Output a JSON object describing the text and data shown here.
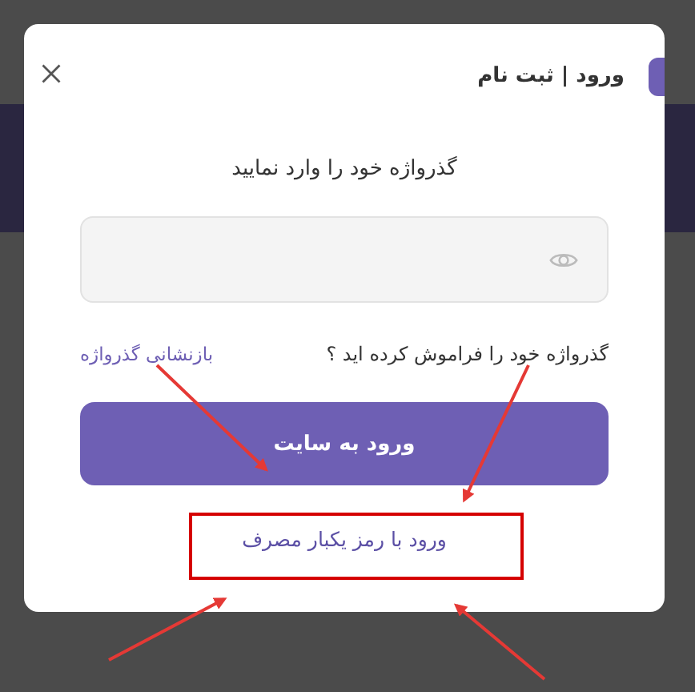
{
  "dialog": {
    "title": "ورود | ثبت نام",
    "prompt": "گذرواژه خود را وارد نمایید",
    "forgot_text": "گذرواژه خود را فراموش کرده اید ؟",
    "reset_link": "بازنشانی گذرواژه",
    "submit_button": "ورود به سایت",
    "otp_link": "ورود با رمز یکبار مصرف"
  }
}
